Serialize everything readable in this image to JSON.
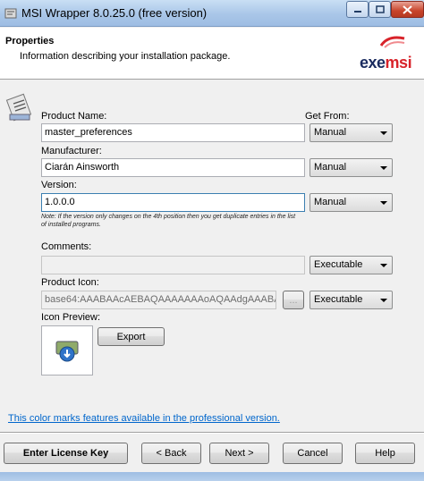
{
  "window": {
    "title": "MSI Wrapper 8.0.25.0 (free version)"
  },
  "header": {
    "title": "Properties",
    "subtitle": "Information describing your installation package.",
    "logo_text": "exemsi",
    "logo_colors": {
      "exe": "#1a2b5f",
      "msi": "#d8232a"
    }
  },
  "form": {
    "get_from_label": "Get From:",
    "product_name": {
      "label": "Product Name:",
      "value": "master_preferences",
      "source": "Manual"
    },
    "manufacturer": {
      "label": "Manufacturer:",
      "value": "Ciarán Ainsworth",
      "source": "Manual"
    },
    "version": {
      "label": "Version:",
      "value": "1.0.0.0",
      "source": "Manual",
      "note": "Note: If the version only changes on the 4th position then you get duplicate entries in the list of installed programs."
    },
    "comments": {
      "label": "Comments:",
      "value": "",
      "source": "Executable"
    },
    "product_icon": {
      "label": "Product Icon:",
      "value": "base64:AAABAAcAEBAQAAAAAAAoAQAAdgAAABA",
      "browse": "...",
      "source": "Executable"
    },
    "icon_preview": {
      "label": "Icon Preview:",
      "export_label": "Export"
    }
  },
  "footer": {
    "link": "This color marks features available in the professional version.",
    "buttons": {
      "license": "Enter License Key",
      "back": "< Back",
      "next": "Next >",
      "cancel": "Cancel",
      "help": "Help"
    }
  }
}
